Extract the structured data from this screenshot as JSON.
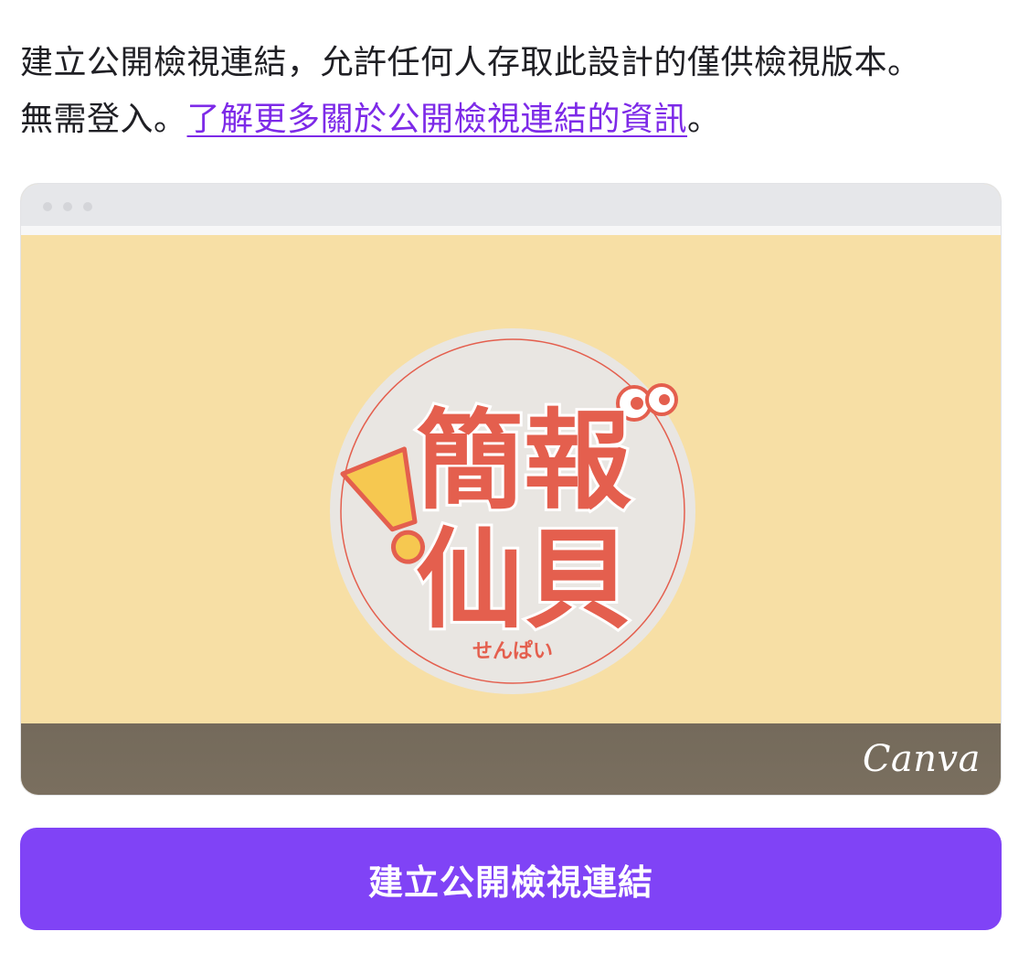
{
  "description": {
    "line1": "建立公開檢視連結，允許任何人存取此設計的僅供檢視版本。",
    "line2_prefix": "無需登入。",
    "link_text": "了解更多關於公開檢視連結的資訊",
    "line2_suffix": "。"
  },
  "preview": {
    "logo_title_top": "簡報",
    "logo_title_bottom": "仙貝",
    "logo_subtitle": "せんぱい",
    "brand": "Canva",
    "colors": {
      "background": "#f7dfa5",
      "circle": "#e9e6e2",
      "logo_red": "#e45f4e",
      "footer": "#766b5c"
    }
  },
  "cta": {
    "label": "建立公開檢視連結",
    "color": "#8043f6"
  }
}
